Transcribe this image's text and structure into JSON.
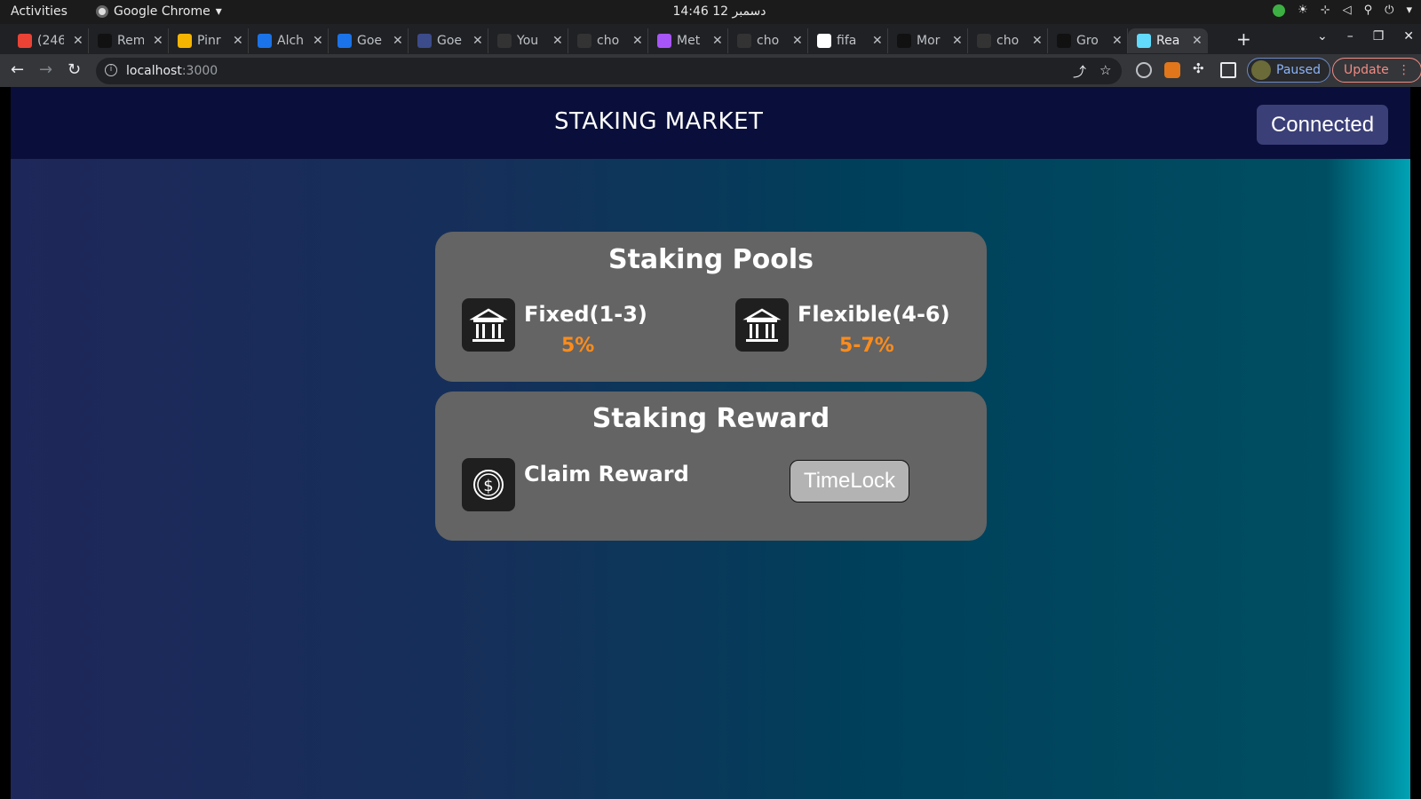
{
  "os_bar": {
    "activities": "Activities",
    "app_name": "Google Chrome",
    "clock": "14:46  12 دسمبر"
  },
  "browser": {
    "tabs": [
      {
        "title": "(246",
        "favicon_color": "#ea4335"
      },
      {
        "title": "Rem",
        "favicon_color": "#111111"
      },
      {
        "title": "Pinr",
        "favicon_color": "#f4b400"
      },
      {
        "title": "Alch",
        "favicon_color": "#1a73e8"
      },
      {
        "title": "Goe",
        "favicon_color": "#1a73e8"
      },
      {
        "title": "Goe",
        "favicon_color": "#3c4b8a"
      },
      {
        "title": "You",
        "favicon_color": "#333333"
      },
      {
        "title": "cho",
        "favicon_color": "#333333"
      },
      {
        "title": "Met",
        "favicon_color": "#a855f7"
      },
      {
        "title": "cho",
        "favicon_color": "#333333"
      },
      {
        "title": "fifa",
        "favicon_color": "#ffffff"
      },
      {
        "title": "Mor",
        "favicon_color": "#111111"
      },
      {
        "title": "cho",
        "favicon_color": "#333333"
      },
      {
        "title": "Gro",
        "favicon_color": "#111111"
      },
      {
        "title": "Rea",
        "favicon_color": "#61dafb",
        "active": true
      }
    ],
    "url_host": "localhost",
    "url_port": ":3000",
    "profile_label": "Paused",
    "update_label": "Update"
  },
  "app": {
    "title": "STAKING MARKET",
    "connect_label": "Connected",
    "pools": {
      "title": "Staking Pools",
      "items": [
        {
          "name": "Fixed(1-3)",
          "rate": "5%",
          "icon": "bank-icon"
        },
        {
          "name": "Flexible(4-6)",
          "rate": "5-7%",
          "icon": "bank-icon"
        }
      ]
    },
    "reward": {
      "title": "Staking Reward",
      "claim_label": "Claim Reward",
      "timelock_label": "TimeLock",
      "icon": "dollar-coin-icon"
    }
  },
  "colors": {
    "accent_rate": "#ff8c1a",
    "header_bg": "#090f3a",
    "card_bg": "#646464",
    "connect_bg": "#3b3f78"
  }
}
